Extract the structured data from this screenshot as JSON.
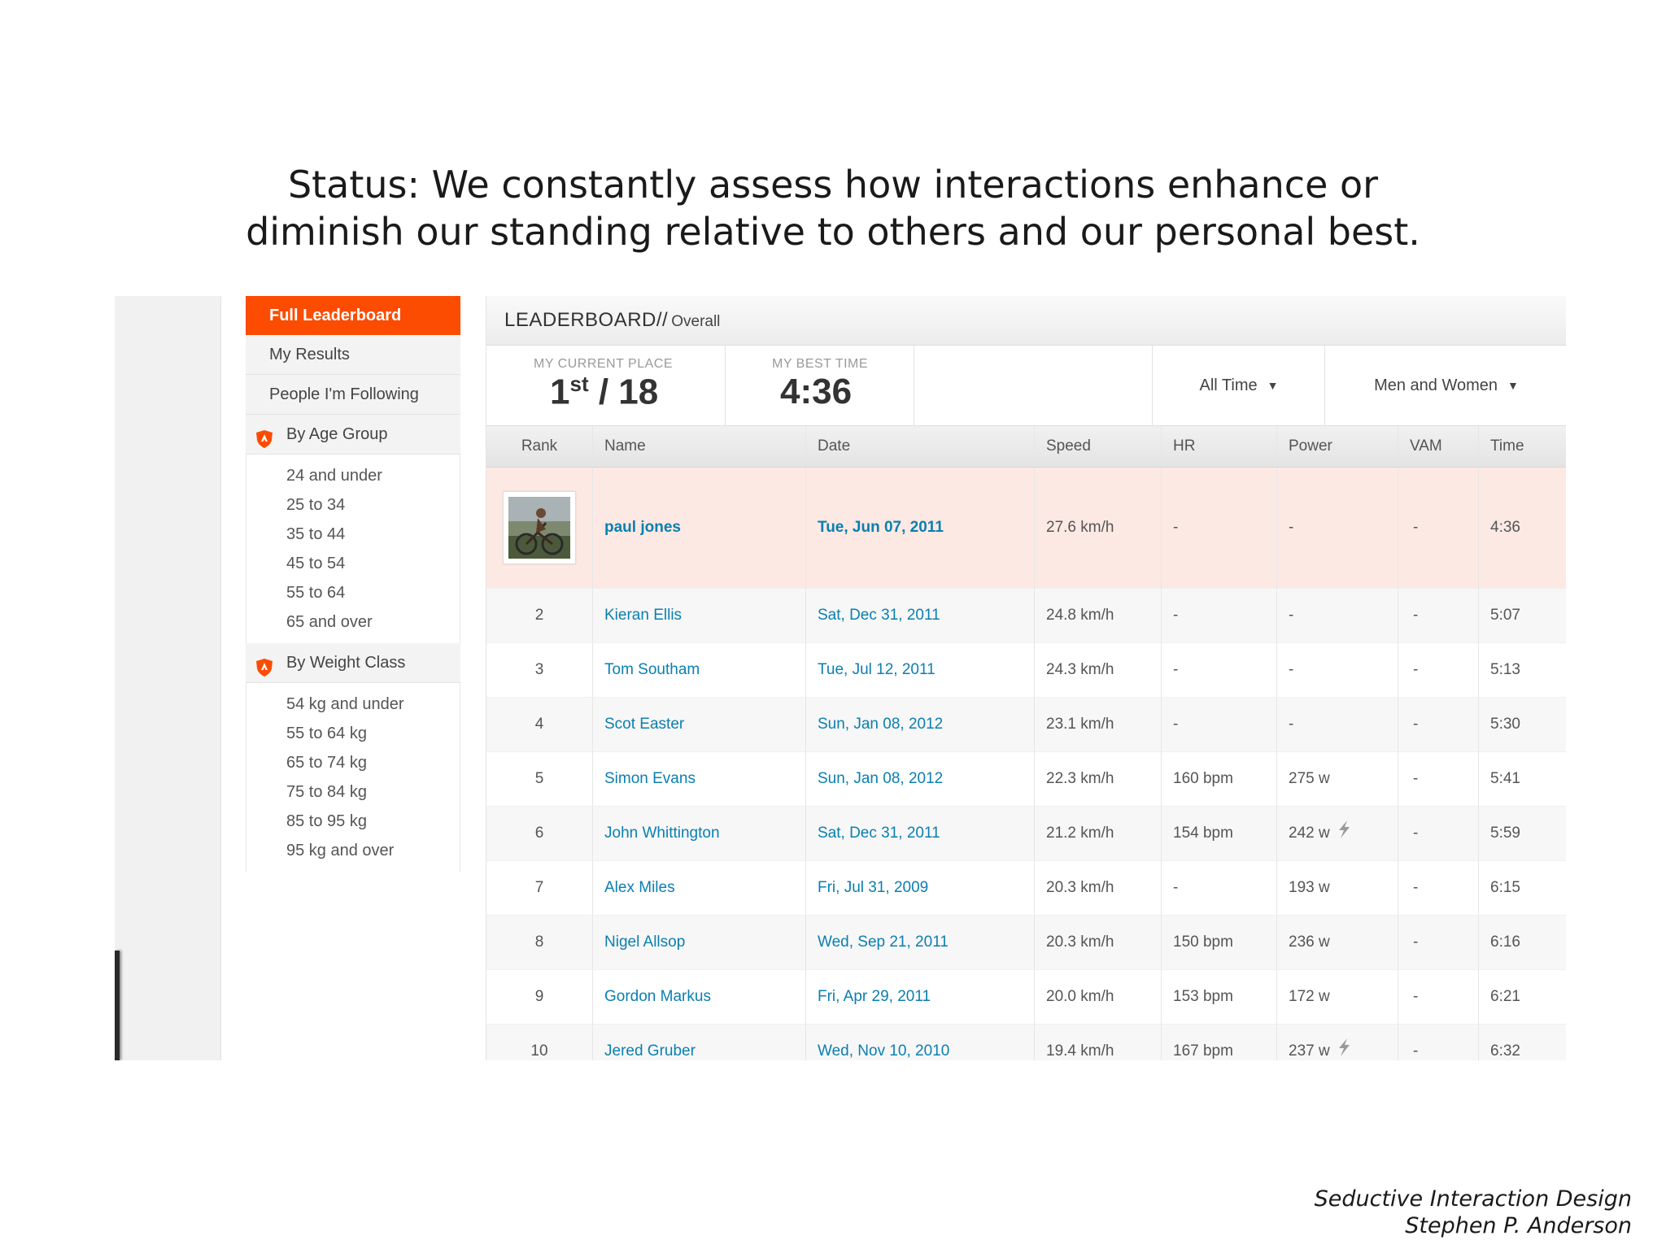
{
  "slide": {
    "title_line1": "Status: We constantly assess how interactions enhance or",
    "title_line2": "diminish our standing relative to others and our personal best.",
    "credit_line1": "Seductive Interaction Design",
    "credit_line2": "Stephen P. Anderson"
  },
  "colors": {
    "accent": "#fc4c02",
    "link": "#0a7fb0",
    "highlight_row": "#fde9e3"
  },
  "sidebar": {
    "active_label": "Full Leaderboard",
    "items": [
      "My Results",
      "People I'm Following"
    ],
    "age_group": {
      "label": "By Age Group",
      "icon": "shield-icon",
      "options": [
        "24 and under",
        "25 to 34",
        "35 to 44",
        "45 to 54",
        "55 to 64",
        "65 and over"
      ]
    },
    "weight_class": {
      "label": "By Weight Class",
      "icon": "shield-icon",
      "options": [
        "54 kg and under",
        "55 to 64 kg",
        "65 to 74 kg",
        "75 to 84 kg",
        "85 to 95 kg",
        "95 kg and over"
      ]
    }
  },
  "leaderboard": {
    "title": "LEADERBOARD//",
    "subtitle": "Overall",
    "current_place_label": "MY CURRENT PLACE",
    "current_place_rank": "1",
    "current_place_suffix": "st",
    "current_place_total": "/ 18",
    "best_time_label": "MY BEST TIME",
    "best_time": "4:36",
    "filter_time": "All Time",
    "filter_gender": "Men and Women",
    "columns": [
      "Rank",
      "Name",
      "Date",
      "Speed",
      "HR",
      "Power",
      "VAM",
      "Time"
    ],
    "rows": [
      {
        "rank": "",
        "name": "paul jones",
        "date": "Tue, Jun 07, 2011",
        "speed": "27.6 km/h",
        "hr": "-",
        "power": "-",
        "power_device": false,
        "vam": "-",
        "time": "4:36",
        "is_me": true
      },
      {
        "rank": "2",
        "name": "Kieran Ellis",
        "date": "Sat, Dec 31, 2011",
        "speed": "24.8 km/h",
        "hr": "-",
        "power": "-",
        "power_device": false,
        "vam": "-",
        "time": "5:07"
      },
      {
        "rank": "3",
        "name": "Tom Southam",
        "date": "Tue, Jul 12, 2011",
        "speed": "24.3 km/h",
        "hr": "-",
        "power": "-",
        "power_device": false,
        "vam": "-",
        "time": "5:13"
      },
      {
        "rank": "4",
        "name": "Scot Easter",
        "date": "Sun, Jan 08, 2012",
        "speed": "23.1 km/h",
        "hr": "-",
        "power": "-",
        "power_device": false,
        "vam": "-",
        "time": "5:30"
      },
      {
        "rank": "5",
        "name": "Simon Evans",
        "date": "Sun, Jan 08, 2012",
        "speed": "22.3 km/h",
        "hr": "160 bpm",
        "power": "275 w",
        "power_device": false,
        "vam": "-",
        "time": "5:41"
      },
      {
        "rank": "6",
        "name": "John Whittington",
        "date": "Sat, Dec 31, 2011",
        "speed": "21.2 km/h",
        "hr": "154 bpm",
        "power": "242 w",
        "power_device": true,
        "vam": "-",
        "time": "5:59"
      },
      {
        "rank": "7",
        "name": "Alex Miles",
        "date": "Fri, Jul 31, 2009",
        "speed": "20.3 km/h",
        "hr": "-",
        "power": "193 w",
        "power_device": false,
        "vam": "-",
        "time": "6:15"
      },
      {
        "rank": "8",
        "name": "Nigel Allsop",
        "date": "Wed, Sep 21, 2011",
        "speed": "20.3 km/h",
        "hr": "150 bpm",
        "power": "236 w",
        "power_device": false,
        "vam": "-",
        "time": "6:16"
      },
      {
        "rank": "9",
        "name": "Gordon Markus",
        "date": "Fri, Apr 29, 2011",
        "speed": "20.0 km/h",
        "hr": "153 bpm",
        "power": "172 w",
        "power_device": false,
        "vam": "-",
        "time": "6:21"
      },
      {
        "rank": "10",
        "name": "Jered Gruber",
        "date": "Wed, Nov 10, 2010",
        "speed": "19.4 km/h",
        "hr": "167 bpm",
        "power": "237 w",
        "power_device": true,
        "vam": "-",
        "time": "6:32"
      }
    ]
  }
}
